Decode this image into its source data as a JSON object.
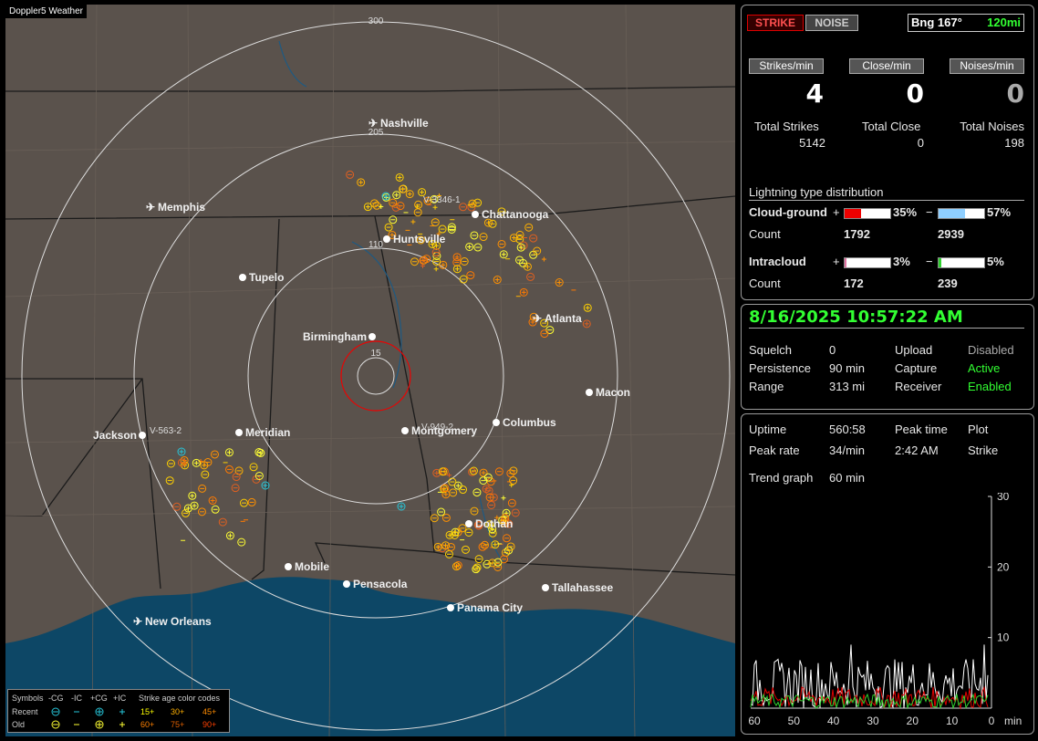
{
  "app": {
    "title": "Doppler5 Weather"
  },
  "map": {
    "range_labels": [
      "300",
      "205",
      "110",
      "15"
    ],
    "cities": [
      {
        "name": "Nashville",
        "airport": true
      },
      {
        "name": "Memphis",
        "airport": true
      },
      {
        "name": "Chattanooga",
        "airport": false
      },
      {
        "name": "Huntsville",
        "airport": false
      },
      {
        "name": "Tupelo",
        "airport": false
      },
      {
        "name": "Atlanta",
        "airport": true
      },
      {
        "name": "Birmingham",
        "airport": false
      },
      {
        "name": "Macon",
        "airport": false
      },
      {
        "name": "Meridian",
        "airport": false
      },
      {
        "name": "Jackson",
        "airport": false
      },
      {
        "name": "Montgomery",
        "airport": false
      },
      {
        "name": "Columbus",
        "airport": false
      },
      {
        "name": "Dothan",
        "airport": false
      },
      {
        "name": "Mobile",
        "airport": false
      },
      {
        "name": "Pensacola",
        "airport": false
      },
      {
        "name": "Tallahassee",
        "airport": false
      },
      {
        "name": "Panama City",
        "airport": false
      },
      {
        "name": "New Orleans",
        "airport": true
      }
    ],
    "vor_labels": [
      "V-3346-1",
      "V-563-2",
      "V-949-2"
    ]
  },
  "legend": {
    "symbols_label": "Symbols",
    "cols": [
      "-CG",
      "-IC",
      "+CG",
      "+IC"
    ],
    "recent_label": "Recent",
    "old_label": "Old",
    "age_title": "Strike age color codes",
    "ages_recent": [
      "15+",
      "30+",
      "45+"
    ],
    "ages_old": [
      "60+",
      "75+",
      "90+"
    ],
    "age_colors_recent": [
      "#ffff00",
      "#ffb000",
      "#ff8c00"
    ],
    "age_colors_old": [
      "#ff8000",
      "#e06000",
      "#ff4000"
    ]
  },
  "header": {
    "strike_btn": "STRIKE",
    "noise_btn": "NOISE",
    "bearing": "Bng 167°",
    "distance": "120mi"
  },
  "rates": {
    "strikes_label": "Strikes/min",
    "strikes_value": "4",
    "close_label": "Close/min",
    "close_value": "0",
    "noises_label": "Noises/min",
    "noises_value": "0"
  },
  "totals": {
    "strikes_label": "Total Strikes",
    "strikes_value": "5142",
    "close_label": "Total Close",
    "close_value": "0",
    "noises_label": "Total Noises",
    "noises_value": "198"
  },
  "distribution": {
    "title": "Lightning type distribution",
    "cg_label": "Cloud-ground",
    "cg_pos_pct": 35,
    "cg_pos_text": "35%",
    "cg_neg_pct": 57,
    "cg_neg_text": "57%",
    "cg_count_label": "Count",
    "cg_pos_count": "1792",
    "cg_neg_count": "2939",
    "ic_label": "Intracloud",
    "ic_pos_pct": 3,
    "ic_pos_text": "3%",
    "ic_neg_pct": 5,
    "ic_neg_text": "5%",
    "ic_count_label": "Count",
    "ic_pos_count": "172",
    "ic_neg_count": "239",
    "plus": "+",
    "minus": "−"
  },
  "status": {
    "datetime": "8/16/2025 10:57:22 AM",
    "squelch_label": "Squelch",
    "squelch_value": "0",
    "persistence_label": "Persistence",
    "persistence_value": "90 min",
    "range_label": "Range",
    "range_value": "313 mi",
    "upload_label": "Upload",
    "upload_value": "Disabled",
    "capture_label": "Capture",
    "capture_value": "Active",
    "receiver_label": "Receiver",
    "receiver_value": "Enabled"
  },
  "stats": {
    "uptime_label": "Uptime",
    "uptime_value": "560:58",
    "peak_time_label": "Peak time",
    "peak_time_value": "2:42 AM",
    "plot_label": "Plot",
    "plot_value": "Strike",
    "peak_rate_label": "Peak rate",
    "peak_rate_value": "34/min",
    "trend_label": "Trend graph",
    "trend_value": "60 min"
  },
  "trend": {
    "y_ticks": [
      "30",
      "20",
      "10"
    ],
    "x_ticks": [
      "60",
      "50",
      "40",
      "30",
      "20",
      "10",
      "0"
    ],
    "x_unit": "min",
    "ymax": 30
  }
}
